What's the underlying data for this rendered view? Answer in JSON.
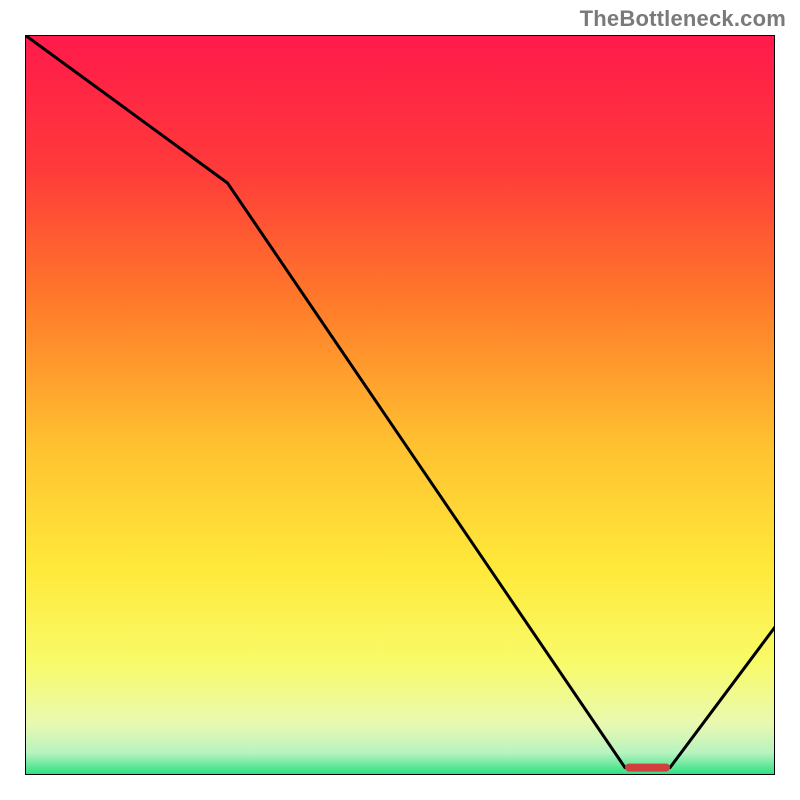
{
  "watermark": "TheBottleneck.com",
  "chart_data": {
    "type": "line",
    "title": "",
    "xlabel": "",
    "ylabel": "",
    "xlim": [
      0,
      100
    ],
    "ylim": [
      0,
      100
    ],
    "x": [
      0,
      27,
      80,
      86,
      100
    ],
    "values": [
      100,
      80,
      1,
      1,
      20
    ],
    "annotations": [],
    "series_color": "#000000",
    "background_gradient_stops": [
      {
        "offset": 0.0,
        "color": "#ff1a4b"
      },
      {
        "offset": 0.18,
        "color": "#ff3a3a"
      },
      {
        "offset": 0.36,
        "color": "#ff7a2a"
      },
      {
        "offset": 0.55,
        "color": "#ffc030"
      },
      {
        "offset": 0.72,
        "color": "#ffe93a"
      },
      {
        "offset": 0.85,
        "color": "#f8fb6a"
      },
      {
        "offset": 0.93,
        "color": "#e9f9b0"
      },
      {
        "offset": 0.97,
        "color": "#b8f3c0"
      },
      {
        "offset": 1.0,
        "color": "#28e07e"
      }
    ],
    "marker": {
      "x_start": 80,
      "x_end": 86,
      "y": 1,
      "color": "#d23d3d"
    }
  }
}
